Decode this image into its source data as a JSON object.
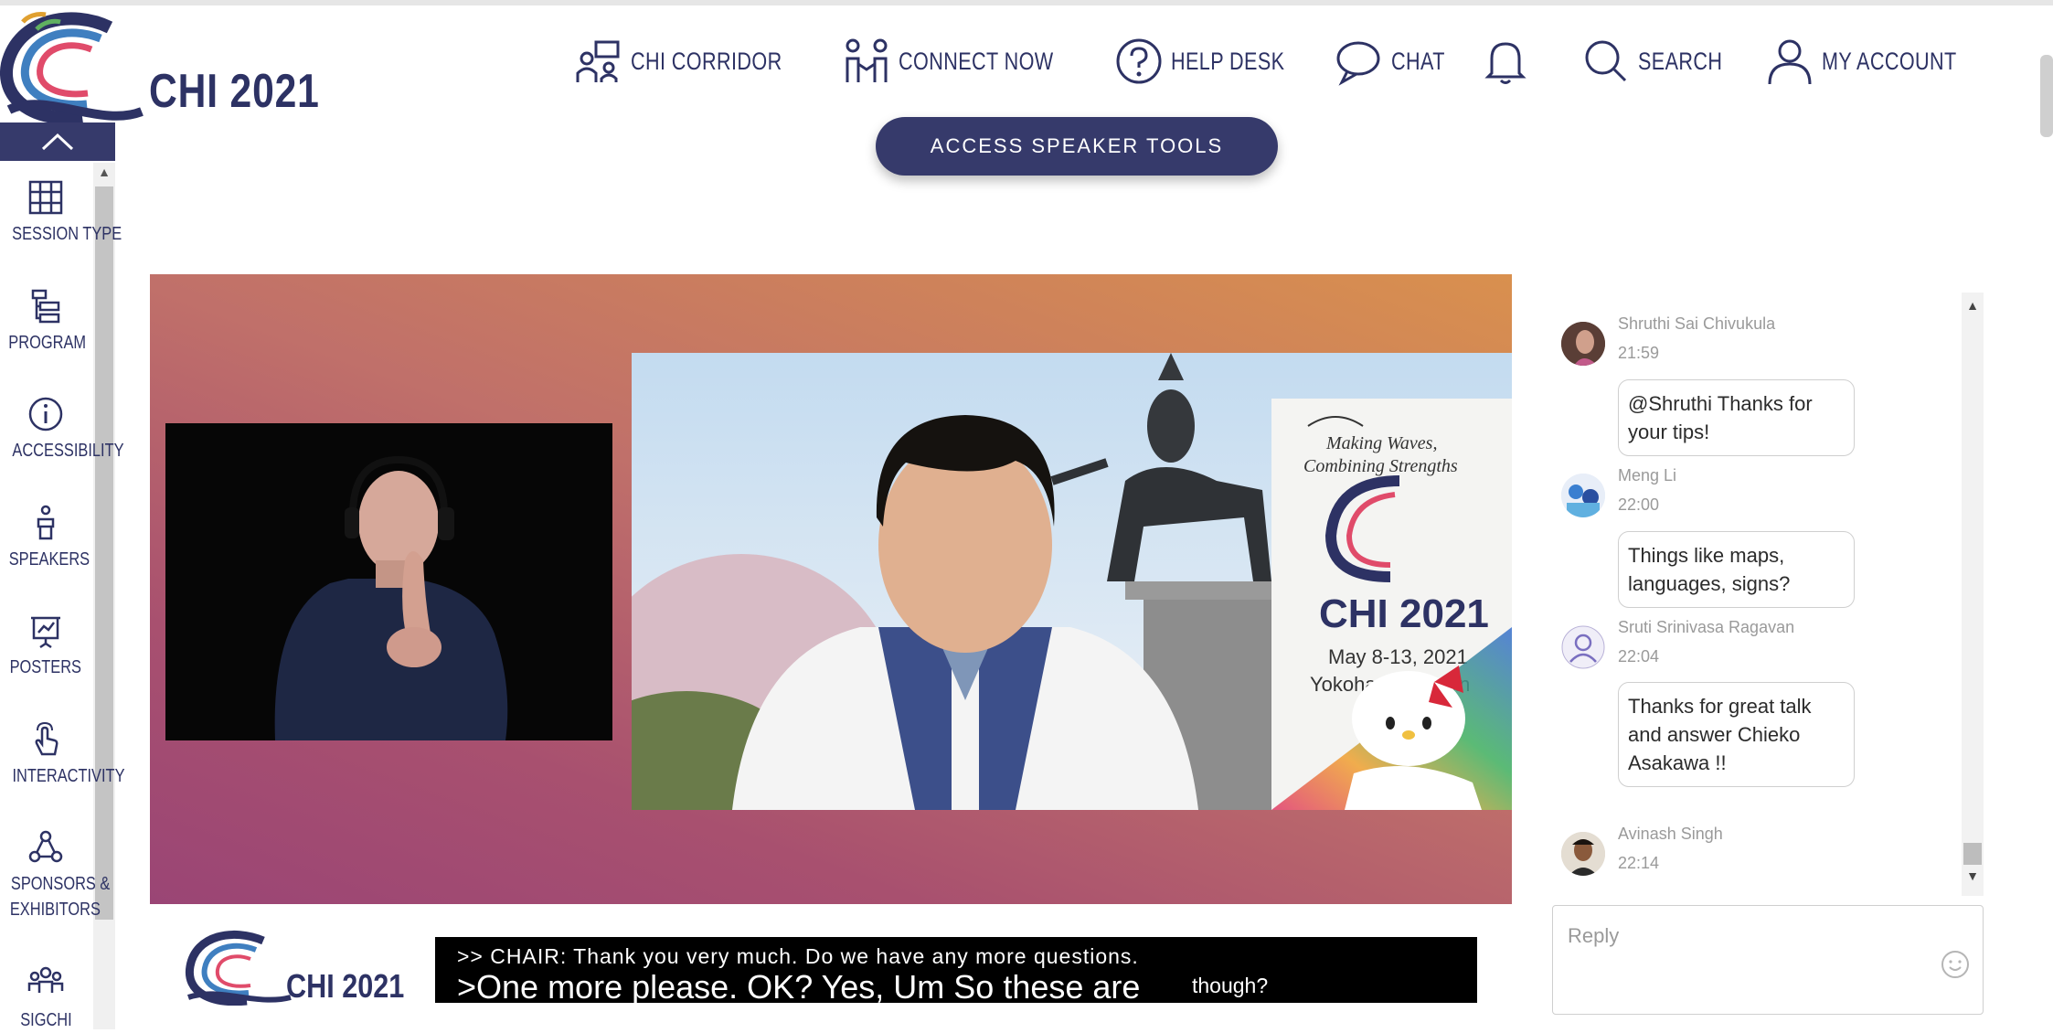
{
  "header": {
    "logo_text": "CHI 2021",
    "nav": [
      {
        "label": "CHI CORRIDOR",
        "icon": "corridor-icon"
      },
      {
        "label": "CONNECT NOW",
        "icon": "connect-icon"
      },
      {
        "label": "HELP DESK",
        "icon": "help-icon"
      },
      {
        "label": "CHAT",
        "icon": "chat-icon"
      },
      {
        "label": "",
        "icon": "bell-icon"
      },
      {
        "label": "SEARCH",
        "icon": "search-icon"
      },
      {
        "label": "MY ACCOUNT",
        "icon": "account-icon"
      }
    ]
  },
  "sidebar": {
    "items": [
      {
        "label": "SESSION TYPE",
        "icon": "grid-icon"
      },
      {
        "label": "PROGRAM",
        "icon": "program-icon"
      },
      {
        "label": "ACCESSIBILITY",
        "icon": "info-icon"
      },
      {
        "label": "SPEAKERS",
        "icon": "speaker-icon"
      },
      {
        "label": "POSTERS",
        "icon": "poster-icon"
      },
      {
        "label": "INTERACTIVITY",
        "icon": "touch-icon"
      },
      {
        "label": "SPONSORS &",
        "label2": "EXHIBITORS",
        "icon": "network-icon"
      },
      {
        "label": "SIGCHI",
        "icon": "people-icon"
      }
    ]
  },
  "speaker_tools_label": "ACCESS SPEAKER TOOLS",
  "video": {
    "banner_lines": [
      "Making Waves,",
      "Combining Strengths"
    ],
    "banner_title": "CHI 2021",
    "banner_date": "May 8-13, 2021",
    "banner_place": "Yokohama, Japan"
  },
  "bottom_logo_text": "CHI 2021",
  "captions": {
    "line1": ">> CHAIR:  Thank you very much.  Do we have any more questions.",
    "line2": ">One more please. OK? Yes, Um So these are",
    "line3": "though?"
  },
  "chat": {
    "messages": [
      {
        "name": "Shruthi Sai Chivukula",
        "time": "21:59",
        "text": "@Shruthi Thanks for your tips!"
      },
      {
        "name": "Meng Li",
        "time": "22:00",
        "text": "Things like maps, languages, signs?"
      },
      {
        "name": "Sruti Srinivasa Ragavan",
        "time": "22:04",
        "text": "Thanks for great talk and answer Chieko Asakawa !!"
      },
      {
        "name": "Avinash Singh",
        "time": "22:14",
        "text": ""
      }
    ],
    "reply_placeholder": "Reply"
  },
  "colors": {
    "brand": "#2d3264",
    "button": "#363a6b"
  }
}
